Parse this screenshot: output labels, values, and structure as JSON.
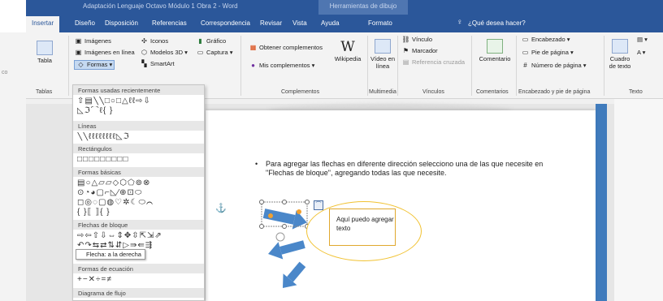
{
  "titlebar": {
    "document_title": "Adaptación Lenguaje Octavo Módulo 1 Obra 2 - Word",
    "context_title": "Herramientas de dibujo"
  },
  "tabs": [
    {
      "label": "Insertar"
    },
    {
      "label": "Diseño"
    },
    {
      "label": "Disposición"
    },
    {
      "label": "Referencias"
    },
    {
      "label": "Correspondencia"
    },
    {
      "label": "Revisar"
    },
    {
      "label": "Vista"
    },
    {
      "label": "Ayuda"
    },
    {
      "label": "Formato"
    }
  ],
  "tell_me": {
    "label": "¿Qué desea hacer?"
  },
  "ribbon": {
    "left_fragment": "co",
    "tabla": {
      "label": "Tabla",
      "group": "Tablas"
    },
    "illustrations": {
      "imagenes": "Imágenes",
      "imagenes_en_linea": "Imágenes en línea",
      "formas": "Formas",
      "iconos": "Iconos",
      "modelos_3d": "Modelos 3D",
      "smartart": "SmartArt",
      "grafico": "Gráfico",
      "captura": "Captura"
    },
    "complementos": {
      "obtener": "Obtener complementos",
      "mis": "Mis complementos",
      "wikipedia": "Wikipedia",
      "group": "Complementos"
    },
    "multimedia": {
      "video": "Vídeo en línea",
      "group": "Multimedia"
    },
    "vinculos": {
      "vinculo": "Vínculo",
      "marcador": "Marcador",
      "referencia": "Referencia cruzada",
      "group": "Vínculos"
    },
    "comentarios": {
      "comentario": "Comentario",
      "group": "Comentarios"
    },
    "encabezado": {
      "encabezado": "Encabezado",
      "pie": "Pie de página",
      "numero": "Número de página",
      "group": "Encabezado y pie de página"
    },
    "texto": {
      "cuadro": "Cuadro de texto",
      "group": "Texto"
    }
  },
  "gutter": {
    "items": [
      "Tablas"
    ]
  },
  "shapes_menu": {
    "sections": [
      {
        "title": "Formas usadas recientemente",
        "glyphs": "⇧▤╲╲□○□△ℓℓ⇨⇩",
        "glyphs2": "◺ℑ⌒ℓ{ }"
      },
      {
        "title": "Líneas",
        "glyphs": "╲╲ℓℓℓℓℓℓℓℓ◺ℑ"
      },
      {
        "title": "Rectángulos",
        "glyphs": "□□□□□□□□□"
      },
      {
        "title": "Formas básicas",
        "glyphs": "▤○△▱▱◇⬡⬠⊚⊗",
        "glyphs2": "⊙◔◕▢⌐◺⁄⊕⊡⬭",
        "glyphs3": "◻◎◌▢◍♡✲☾⬭⌒",
        "glyphs4": "{ }⟦ ⟧{ }"
      },
      {
        "title": "Flechas de bloque",
        "glyphs": "⇨⇦⇧⇩⇔⇕✥⇳⇱⇲⇗",
        "glyphs2": "↶↷⇆⇄⇅⇵▷⇛⇚⇶"
      },
      {
        "title": "Formas de ecuación",
        "glyphs": "+−✕÷=≠"
      },
      {
        "title": "Diagrama de flujo",
        "glyphs": ""
      }
    ],
    "tooltip": "Flecha: a la derecha"
  },
  "document": {
    "bullet": "•",
    "body": "Para agregar las flechas en diferente dirección selecciono una de las que necesite en \"Flechas de bloque\", agregando todas las que necesite.",
    "callout_text": "Aquí puedo agregar texto"
  },
  "colors": {
    "ribbon_blue": "#2b579a",
    "arrow_blue": "#4a87c9",
    "callout_border": "#f1c232"
  }
}
